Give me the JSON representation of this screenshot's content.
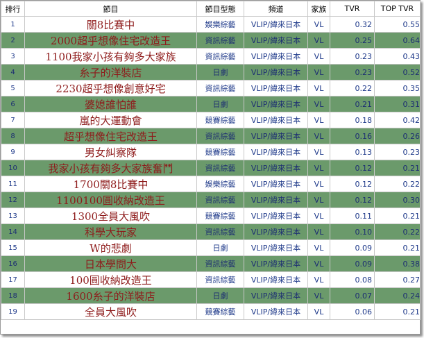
{
  "headers": {
    "rank": "排行",
    "title": "節目",
    "genre": "節目型態",
    "channel": "頻道",
    "family": "家族",
    "tvr": "TVR",
    "top_tvr": "TOP TVR"
  },
  "rows": [
    {
      "rank": "1",
      "title": "關8比賽中",
      "genre": "娛樂綜藝",
      "channel": "VLIP/緯來日本",
      "family": "VL",
      "tvr": "0.32",
      "top_tvr": "0.55"
    },
    {
      "rank": "2",
      "title": "2000超乎想像住宅改造王",
      "genre": "資訊綜藝",
      "channel": "VLIP/緯來日本",
      "family": "VL",
      "tvr": "0.25",
      "top_tvr": "0.64"
    },
    {
      "rank": "3",
      "title": "1100我家小孩有夠多大家族",
      "genre": "資訊綜藝",
      "channel": "VLIP/緯來日本",
      "family": "VL",
      "tvr": "0.23",
      "top_tvr": "0.43"
    },
    {
      "rank": "4",
      "title": "糸子的洋裝店",
      "genre": "日劇",
      "channel": "VLIP/緯來日本",
      "family": "VL",
      "tvr": "0.23",
      "top_tvr": "0.52"
    },
    {
      "rank": "5",
      "title": "2230超乎想像創意好宅",
      "genre": "資訊綜藝",
      "channel": "VLIP/緯來日本",
      "family": "VL",
      "tvr": "0.22",
      "top_tvr": "0.35"
    },
    {
      "rank": "6",
      "title": "婆媳誰怕誰",
      "genre": "日劇",
      "channel": "VLIP/緯來日本",
      "family": "VL",
      "tvr": "0.21",
      "top_tvr": "0.31"
    },
    {
      "rank": "7",
      "title": "嵐的大運動會",
      "genre": "競賽綜藝",
      "channel": "VLIP/緯來日本",
      "family": "VL",
      "tvr": "0.18",
      "top_tvr": "0.42"
    },
    {
      "rank": "8",
      "title": "超乎想像住宅改造王",
      "genre": "資訊綜藝",
      "channel": "VLIP/緯來日本",
      "family": "VL",
      "tvr": "0.16",
      "top_tvr": "0.26"
    },
    {
      "rank": "9",
      "title": "男女糾察隊",
      "genre": "競賽綜藝",
      "channel": "VLIP/緯來日本",
      "family": "VL",
      "tvr": "0.13",
      "top_tvr": "0.23"
    },
    {
      "rank": "10",
      "title": "我家小孩有夠多大家族奮鬥",
      "genre": "資訊綜藝",
      "channel": "VLIP/緯來日本",
      "family": "VL",
      "tvr": "0.12",
      "top_tvr": "0.21"
    },
    {
      "rank": "11",
      "title": "1700關8比賽中",
      "genre": "娛樂綜藝",
      "channel": "VLIP/緯來日本",
      "family": "VL",
      "tvr": "0.12",
      "top_tvr": "0.22"
    },
    {
      "rank": "12",
      "title": "1100100圓收納改造王",
      "genre": "資訊綜藝",
      "channel": "VLIP/緯來日本",
      "family": "VL",
      "tvr": "0.12",
      "top_tvr": "0.30"
    },
    {
      "rank": "13",
      "title": "1300全員大風吹",
      "genre": "競賽綜藝",
      "channel": "VLIP/緯來日本",
      "family": "VL",
      "tvr": "0.11",
      "top_tvr": "0.21"
    },
    {
      "rank": "14",
      "title": "科學大玩家",
      "genre": "資訊綜藝",
      "channel": "VLIP/緯來日本",
      "family": "VL",
      "tvr": "0.10",
      "top_tvr": "0.22"
    },
    {
      "rank": "15",
      "title": "W的悲劇",
      "genre": "日劇",
      "channel": "VLIP/緯來日本",
      "family": "VL",
      "tvr": "0.09",
      "top_tvr": "0.21"
    },
    {
      "rank": "16",
      "title": "日本學問大",
      "genre": "資訊綜藝",
      "channel": "VLIP/緯來日本",
      "family": "VL",
      "tvr": "0.09",
      "top_tvr": "0.38"
    },
    {
      "rank": "17",
      "title": "100圓收納改造王",
      "genre": "資訊綜藝",
      "channel": "VLIP/緯來日本",
      "family": "VL",
      "tvr": "0.08",
      "top_tvr": "0.27"
    },
    {
      "rank": "18",
      "title": "1600糸子的洋裝店",
      "genre": "日劇",
      "channel": "VLIP/緯來日本",
      "family": "VL",
      "tvr": "0.07",
      "top_tvr": "0.24"
    },
    {
      "rank": "19",
      "title": "全員大風吹",
      "genre": "競賽綜藝",
      "channel": "VLIP/緯來日本",
      "family": "VL",
      "tvr": "0.06",
      "top_tvr": "0.21"
    }
  ],
  "colors": {
    "row_alt_background": "#6b9a6b",
    "title_text": "#8e1b1b",
    "value_text": "#1f3a8a"
  }
}
